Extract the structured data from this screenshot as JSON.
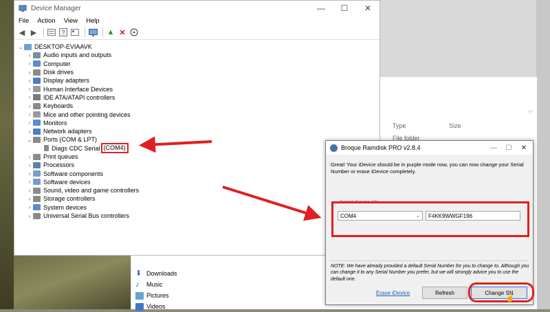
{
  "device_manager": {
    "title": "Device Manager",
    "menu": [
      "File",
      "Action",
      "View",
      "Help"
    ],
    "tree": {
      "root": "DESKTOP-EVIAAVK",
      "categories": [
        "Audio inputs and outputs",
        "Computer",
        "Disk drives",
        "Display adapters",
        "Human Interface Devices",
        "IDE ATA/ATAPI controllers",
        "Keyboards",
        "Mice and other pointing devices",
        "Monitors",
        "Network adapters",
        "Ports (COM & LPT)"
      ],
      "port_child": "Diags CDC Serial",
      "port_child_com": "(COM4)",
      "categories_after": [
        "Print queues",
        "Processors",
        "Software components",
        "Software devices",
        "Sound, video and game controllers",
        "Storage controllers",
        "System devices",
        "Universal Serial Bus controllers"
      ]
    }
  },
  "explorer": {
    "columns": [
      "Type",
      "Size"
    ],
    "file_type": "File folder",
    "nav_items": [
      "Downloads",
      "Music",
      "Pictures",
      "Videos"
    ]
  },
  "dialog": {
    "title": "Broque Ramdisk PRO v2.8.4",
    "message": "Great! Your iDevice should be in purple mode now, you can now change your Serial Number or erase iDevice completely.",
    "group_label": "Select iDevice SN",
    "com_selected": "COM4",
    "serial_value": "F4KK9WWGF196",
    "note": "NOTE: We have already provided a default Serial Number for you to change to. Although you can change it to any Serial Number you prefer, but we will strongly advice you to use the default one.",
    "erase_label": "Erase iDevice",
    "refresh_label": "Refresh",
    "change_label": "Change SN"
  },
  "colors": {
    "annotation_red": "#e02020",
    "link_blue": "#1a5fb4"
  }
}
